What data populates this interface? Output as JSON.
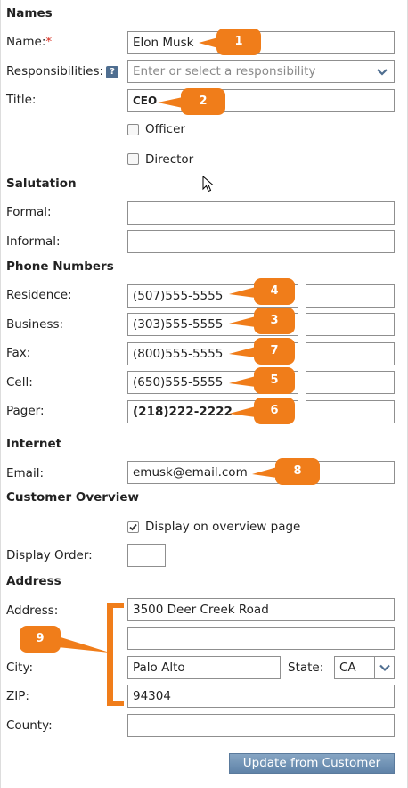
{
  "sections": {
    "names": "Names",
    "salutation": "Salutation",
    "phone_numbers": "Phone Numbers",
    "internet": "Internet",
    "customer_overview": "Customer Overview",
    "address": "Address"
  },
  "names": {
    "name_label": "Name:",
    "required_mark": "*",
    "name_value": "Elon Musk",
    "responsibilities_label": "Responsibilities:",
    "help_icon": "?",
    "responsibilities_placeholder": "Enter or select a responsibility",
    "title_label": "Title:",
    "title_value": "CEO",
    "officer_label": "Officer",
    "director_label": "Director"
  },
  "salutation": {
    "formal_label": "Formal:",
    "informal_label": "Informal:"
  },
  "phones": {
    "residence_label": "Residence:",
    "residence_value": "(507)555-5555",
    "business_label": "Business:",
    "business_value": "(303)555-5555",
    "fax_label": "Fax:",
    "fax_value": "(800)555-5555",
    "cell_label": "Cell:",
    "cell_value": "(650)555-5555",
    "pager_label": "Pager:",
    "pager_value": "(218)222-2222"
  },
  "internet": {
    "email_label": "Email:",
    "email_value": "emusk@email.com"
  },
  "overview": {
    "display_label": "Display on overview page",
    "display_checked": true,
    "display_order_label": "Display Order:"
  },
  "address": {
    "address_label": "Address:",
    "line1_value": "3500 Deer Creek Road",
    "city_label": "City:",
    "city_value": "Palo Alto",
    "state_label": "State:",
    "state_value": "CA",
    "zip_label": "ZIP:",
    "zip_value": "94304",
    "county_label": "County:"
  },
  "actions": {
    "update_label": "Update from Customer"
  },
  "callouts": {
    "c1": "1",
    "c2": "2",
    "c3": "3",
    "c4": "4",
    "c5": "5",
    "c6": "6",
    "c7": "7",
    "c8": "8",
    "c9": "9"
  },
  "colors": {
    "callout": "#f07d1a",
    "button": "#6f92b6",
    "required": "#d62d20"
  }
}
